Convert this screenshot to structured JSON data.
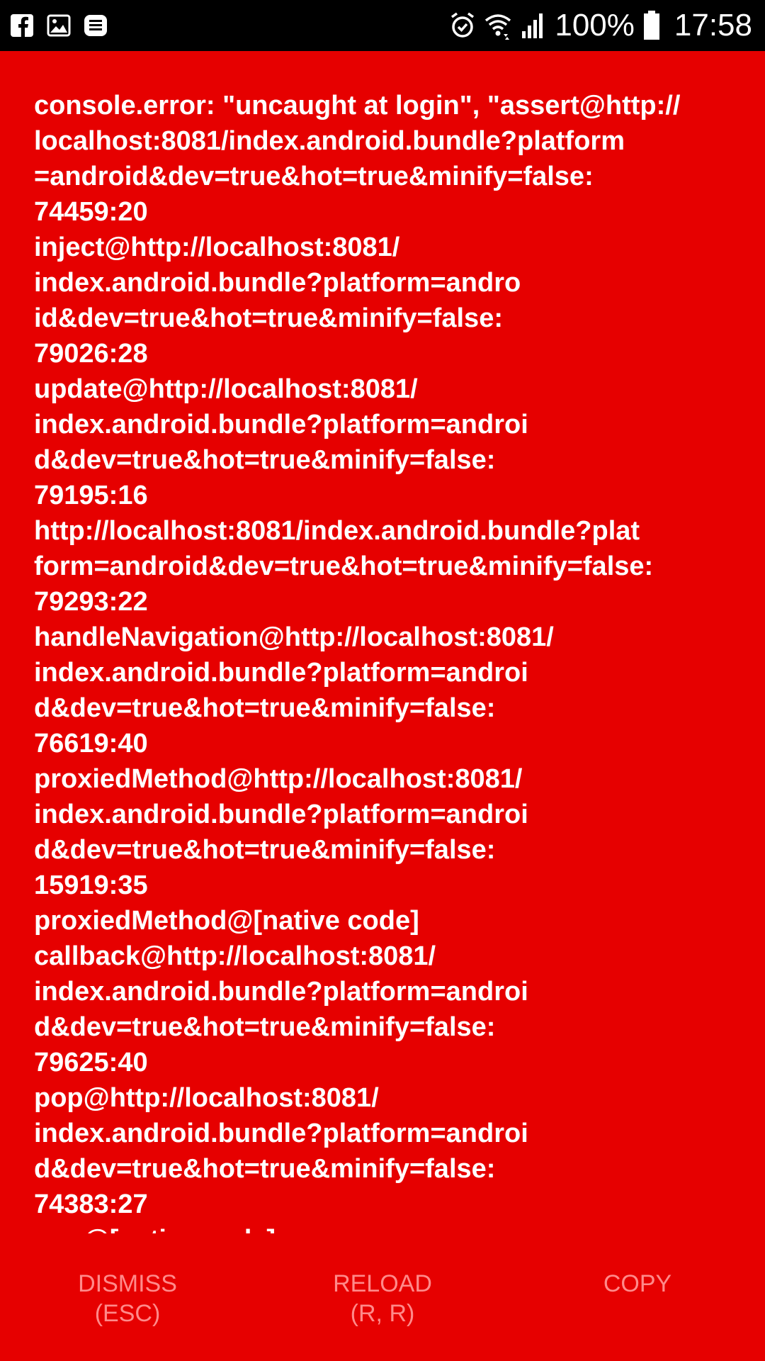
{
  "status_bar": {
    "left_icons": [
      "facebook-icon",
      "gallery-icon",
      "message-icon"
    ],
    "right_icons": [
      "alarm-icon",
      "wifi-icon",
      "signal-icon",
      "battery-icon"
    ],
    "battery": "100%",
    "time": "17:58"
  },
  "error": {
    "lines": [
      "console.error: \"uncaught at login\", \"assert@http://",
      "localhost:8081/index.android.bundle?platform",
      "=android&dev=true&hot=true&minify=false:",
      "74459:20",
      "inject@http://localhost:8081/",
      "index.android.bundle?platform=andro",
      "id&dev=true&hot=true&minify=false:",
      "79026:28",
      "update@http://localhost:8081/",
      "index.android.bundle?platform=androi",
      "d&dev=true&hot=true&minify=false:",
      "79195:16",
      "http://localhost:8081/index.android.bundle?plat",
      "form=android&dev=true&hot=true&minify=false:",
      "79293:22",
      "handleNavigation@http://localhost:8081/",
      "index.android.bundle?platform=androi",
      "d&dev=true&hot=true&minify=false:",
      "76619:40",
      "proxiedMethod@http://localhost:8081/",
      "index.android.bundle?platform=androi",
      "d&dev=true&hot=true&minify=false:",
      "15919:35",
      "proxiedMethod@[native code]",
      "callback@http://localhost:8081/",
      "index.android.bundle?platform=androi",
      "d&dev=true&hot=true&minify=false:",
      "79625:40",
      "pop@http://localhost:8081/",
      "index.android.bundle?platform=androi",
      "d&dev=true&hot=true&minify=false:",
      "74383:27",
      "pop@[native code]"
    ]
  },
  "buttons": {
    "dismiss": {
      "label": "DISMISS",
      "shortcut": "(ESC)"
    },
    "reload": {
      "label": "RELOAD",
      "shortcut": "(R, R)"
    },
    "copy": {
      "label": "COPY"
    }
  },
  "colors": {
    "background": "#e60000",
    "status_bar": "#000000",
    "text": "#ffffff",
    "button_text": "#ff8a8a"
  }
}
